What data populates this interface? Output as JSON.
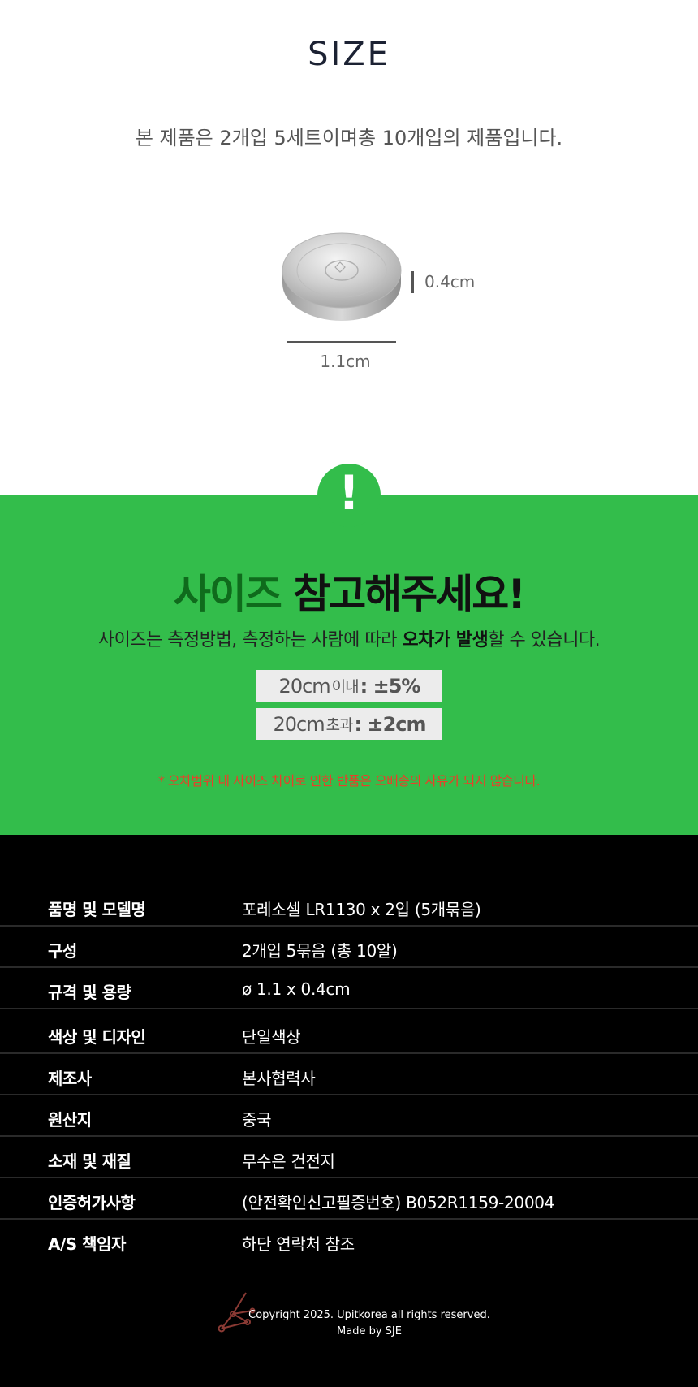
{
  "size": {
    "title": "SIZE",
    "description": "본 제품은 2개입 5세트이며총 10개입의 제품입니다.",
    "height_label": "0.4cm",
    "width_label": "1.1cm"
  },
  "notice": {
    "heading_part1": "사이즈",
    "heading_part2": "참고해주세요!",
    "sub_part1": "사이즈는 측정방법, 측정하는 사람에 따라 ",
    "sub_bold": "오차가 발생",
    "sub_part2": "할 수 있습니다.",
    "tolerance_1": {
      "size": "20cm",
      "qualifier": "이내",
      "value": ": ±5%"
    },
    "tolerance_2": {
      "size": "20cm",
      "qualifier": "초과",
      "value": ": ±2cm"
    },
    "disclaimer": "* 오차범위 내 사이즈 차이로 인한 반품은 오배송의 사유가 되지 않습니다."
  },
  "specs": [
    {
      "key": "품명 및 모델명",
      "value": "포레소셀 LR1130 x 2입 (5개묶음)"
    },
    {
      "key": "구성",
      "value": "2개입 5묶음 (총 10알)"
    },
    {
      "key": "규격 및 용량",
      "value": "ø 1.1 x 0.4cm"
    },
    {
      "key": "색상 및 디자인",
      "value": "단일색상"
    },
    {
      "key": "제조사",
      "value": "본사협력사"
    },
    {
      "key": "원산지",
      "value": "중국"
    },
    {
      "key": "소재 및 재질",
      "value": "무수은 건전지"
    },
    {
      "key": "인증허가사항",
      "value": "(안전확인신고필증번호) B052R1159-20004"
    },
    {
      "key": "A/S 책임자",
      "value": "하단 연락처 참조"
    }
  ],
  "footer": {
    "copyright": "Copyright 2025. Upitkorea all rights reserved.",
    "made_by": "Made by SJE"
  },
  "colors": {
    "green_bg": "#33bd4b",
    "heading_dark_green": "#0f6b1c",
    "notice_red": "#e8402a",
    "table_bg": "#000000"
  },
  "icons": {
    "alert": "exclamation-icon",
    "logo": "constellation-logo-icon"
  }
}
